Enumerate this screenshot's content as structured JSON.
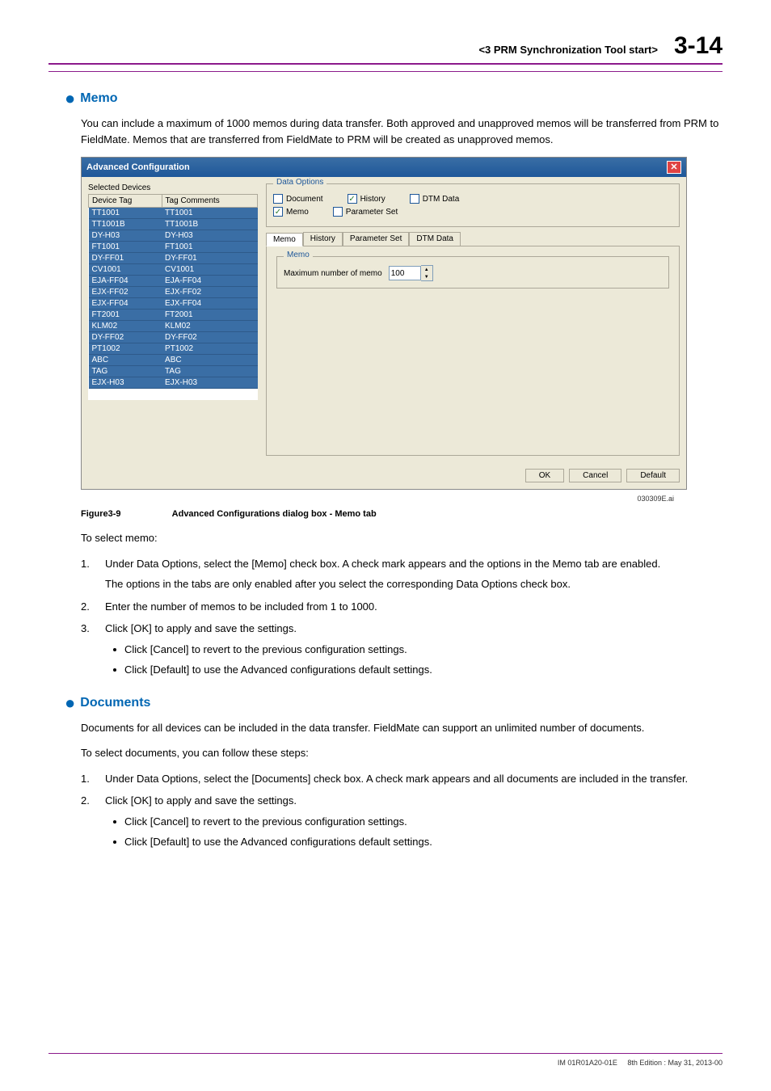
{
  "header": {
    "section": "<3  PRM Synchronization Tool start>",
    "page": "3-14"
  },
  "memo": {
    "title": "Memo",
    "intro": "You can include a maximum of 1000 memos during data transfer. Both approved and unapproved memos will be transferred from PRM to FieldMate. Memos that are transferred from FieldMate to PRM will be created as unapproved memos."
  },
  "dialog": {
    "title": "Advanced Configuration",
    "selected_devices_label": "Selected Devices",
    "columns": {
      "tag": "Device Tag",
      "comments": "Tag Comments"
    },
    "devices": [
      {
        "tag": "TT1001",
        "comments": "TT1001"
      },
      {
        "tag": "TT1001B",
        "comments": "TT1001B"
      },
      {
        "tag": "DY-H03",
        "comments": "DY-H03"
      },
      {
        "tag": "FT1001",
        "comments": "FT1001"
      },
      {
        "tag": "DY-FF01",
        "comments": "DY-FF01"
      },
      {
        "tag": "CV1001",
        "comments": "CV1001"
      },
      {
        "tag": "EJA-FF04",
        "comments": "EJA-FF04"
      },
      {
        "tag": "EJX-FF02",
        "comments": "EJX-FF02"
      },
      {
        "tag": "EJX-FF04",
        "comments": "EJX-FF04"
      },
      {
        "tag": "FT2001",
        "comments": "FT2001"
      },
      {
        "tag": "KLM02",
        "comments": "KLM02"
      },
      {
        "tag": "DY-FF02",
        "comments": "DY-FF02"
      },
      {
        "tag": "PT1002",
        "comments": "PT1002"
      },
      {
        "tag": "ABC",
        "comments": "ABC"
      },
      {
        "tag": "TAG",
        "comments": "TAG"
      },
      {
        "tag": "EJX-H03",
        "comments": "EJX-H03"
      }
    ],
    "data_options": {
      "title": "Data Options",
      "document": "Document",
      "history": "History",
      "dtm_data": "DTM Data",
      "memo": "Memo",
      "parameter_set": "Parameter Set"
    },
    "tabs": {
      "memo": "Memo",
      "history": "History",
      "parameter_set": "Parameter Set",
      "dtm_data": "DTM Data"
    },
    "memo_group": {
      "title": "Memo",
      "label": "Maximum number of memo",
      "value": "100"
    },
    "buttons": {
      "ok": "OK",
      "cancel": "Cancel",
      "default": "Default"
    }
  },
  "figure": {
    "ref": "030309E.ai",
    "label": "Figure3-9",
    "caption": "Advanced Configurations dialog box - Memo tab"
  },
  "memo_steps": {
    "intro": "To select memo:",
    "items": [
      {
        "num": "1.",
        "text": "Under Data Options, select the [Memo] check box. A check mark appears and the options in the Memo tab are enabled.",
        "sub_para": "The options in the tabs are only enabled after you select the corresponding Data Options check box."
      },
      {
        "num": "2.",
        "text": "Enter the number of memos to be included from 1 to 1000."
      },
      {
        "num": "3.",
        "text": "Click [OK] to apply and save the settings.",
        "bullets": [
          "Click [Cancel] to revert to the previous configuration settings.",
          "Click [Default] to use the Advanced configurations default settings."
        ]
      }
    ]
  },
  "documents": {
    "title": "Documents",
    "intro": "Documents for all devices can be included in the data transfer. FieldMate can support an unlimited number of documents.",
    "intro2": "To select documents, you can follow these steps:",
    "items": [
      {
        "num": "1.",
        "text": "Under Data Options, select the [Documents] check box. A check mark appears and all documents are included in the transfer."
      },
      {
        "num": "2.",
        "text": "Click [OK] to apply and save the settings.",
        "bullets": [
          "Click [Cancel] to revert to the previous configuration settings.",
          "Click [Default] to use the Advanced configurations default settings."
        ]
      }
    ]
  },
  "footer": {
    "doc_id": "IM 01R01A20-01E",
    "edition": "8th Edition : May 31, 2013-00"
  }
}
